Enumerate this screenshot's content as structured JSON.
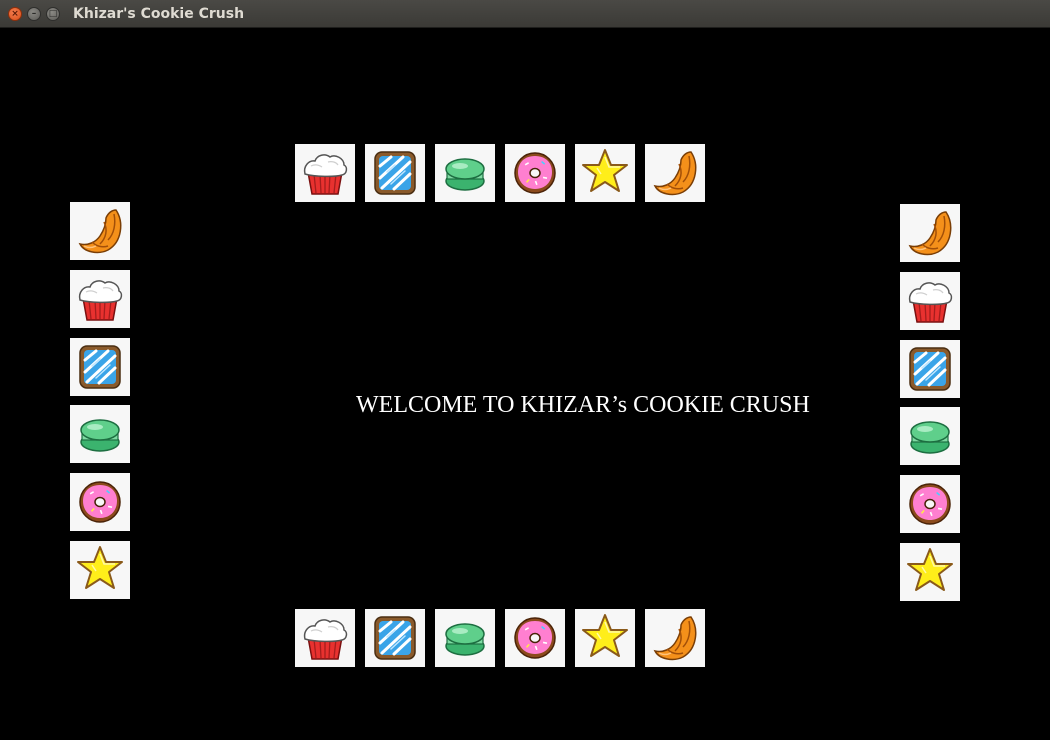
{
  "window": {
    "title": "Khizar's Cookie Crush"
  },
  "welcome_text": "WELCOME TO KHIZAR’s COOKIE CRUSH",
  "borders": {
    "top": [
      "cupcake",
      "danish",
      "macaron",
      "donut",
      "star-cookie",
      "croissant"
    ],
    "left": [
      "croissant",
      "cupcake",
      "danish",
      "macaron",
      "donut",
      "star-cookie"
    ],
    "right": [
      "croissant",
      "cupcake",
      "danish",
      "macaron",
      "donut",
      "star-cookie"
    ],
    "bottom": [
      "cupcake",
      "danish",
      "macaron",
      "donut",
      "star-cookie",
      "croissant"
    ]
  },
  "colors": {
    "background": "#000000",
    "tile": "#f7f7f7",
    "text": "#ffffff"
  }
}
